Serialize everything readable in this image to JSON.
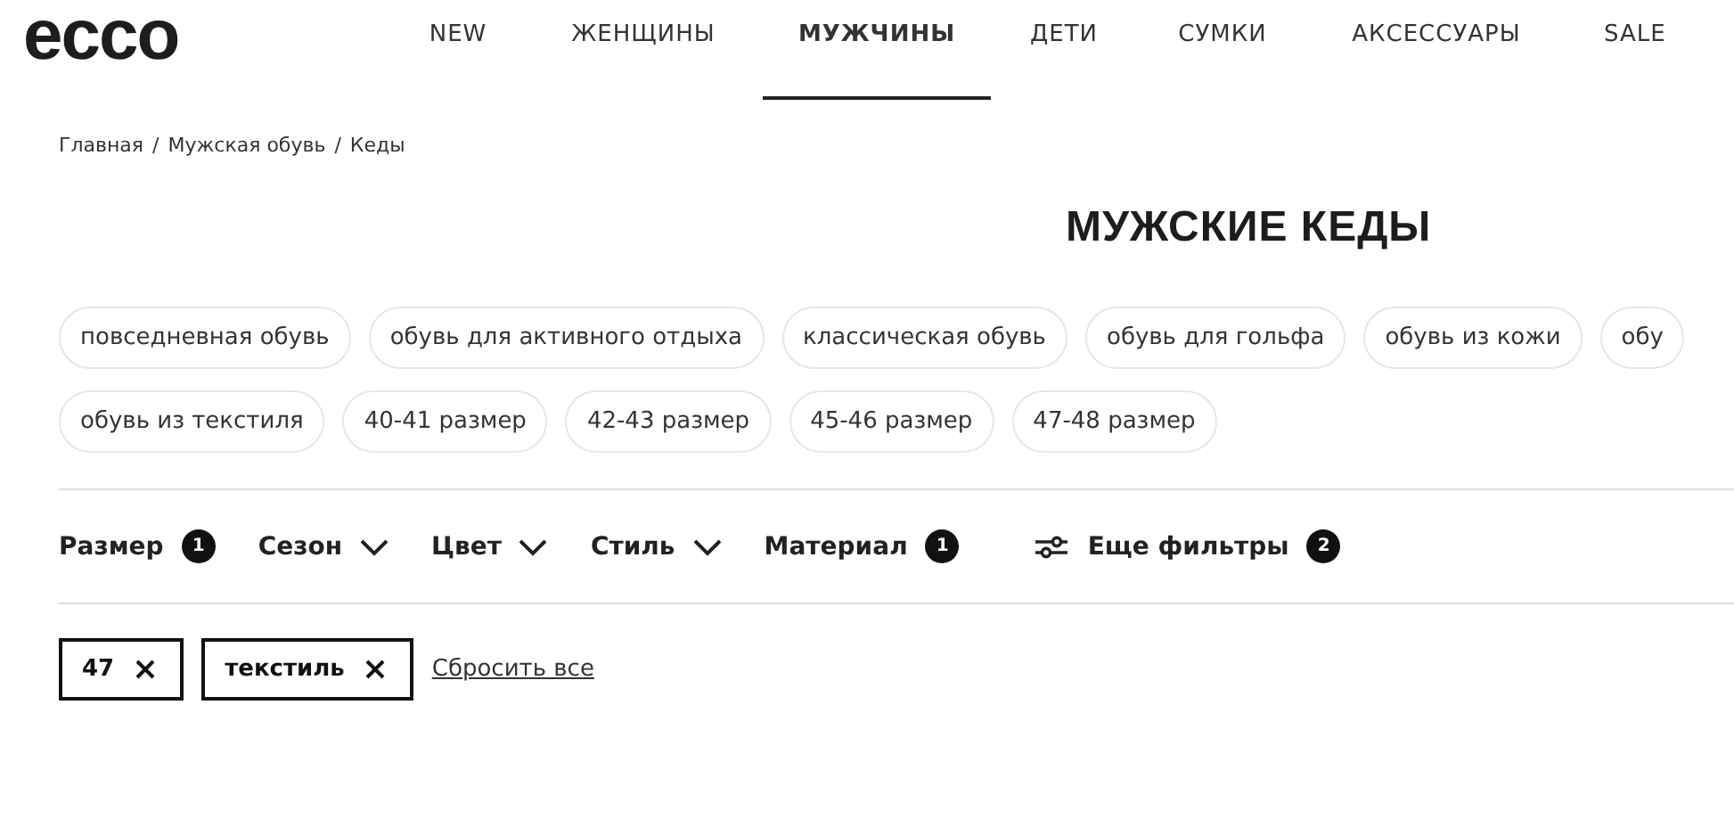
{
  "logo": "ecco",
  "nav": [
    {
      "label": "NEW",
      "selected": false
    },
    {
      "label": "ЖЕНЩИНЫ",
      "selected": false
    },
    {
      "label": "МУЖЧИНЫ",
      "selected": true
    },
    {
      "label": "ДЕТИ",
      "selected": false
    },
    {
      "label": "СУМКИ",
      "selected": false
    },
    {
      "label": "АКСЕССУАРЫ",
      "selected": false
    },
    {
      "label": "SALE",
      "selected": false
    }
  ],
  "breadcrumbs": [
    "Главная",
    "Мужская обувь",
    "Кеды"
  ],
  "breadcrumb_separator": "/",
  "title": "МУЖСКИЕ КЕДЫ",
  "chip_rows": [
    [
      "повседневная обувь",
      "обувь для активного отдыха",
      "классическая обувь",
      "обувь для гольфа",
      "обувь из кожи",
      "обу"
    ],
    [
      "обувь из текстиля",
      "40-41 размер",
      "42-43 размер",
      "45-46 размер",
      "47-48 размер"
    ]
  ],
  "filters": [
    {
      "label": "Размер",
      "kind": "count",
      "count": "1"
    },
    {
      "label": "Сезон",
      "kind": "dropdown"
    },
    {
      "label": "Цвет",
      "kind": "dropdown"
    },
    {
      "label": "Стиль",
      "kind": "dropdown"
    },
    {
      "label": "Материал",
      "kind": "count",
      "count": "1"
    },
    {
      "label": "Еще фильтры",
      "kind": "more",
      "count": "2"
    }
  ],
  "active_filters": [
    "47",
    "текстиль"
  ],
  "reset": "Сбросить все"
}
